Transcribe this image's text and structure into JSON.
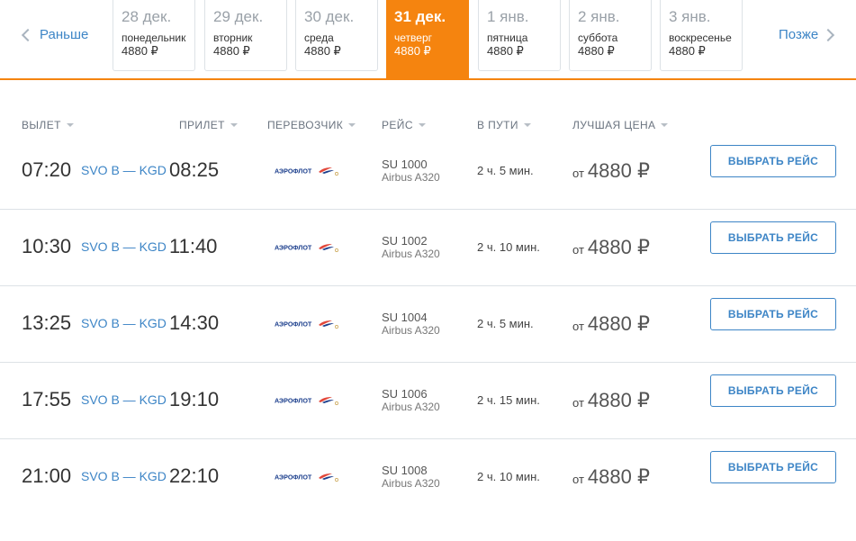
{
  "nav": {
    "prev_label": "Раньше",
    "next_label": "Позже"
  },
  "dates": [
    {
      "date": "28 дек.",
      "weekday": "понедельник",
      "price": "4880 ₽",
      "active": false
    },
    {
      "date": "29 дек.",
      "weekday": "вторник",
      "price": "4880 ₽",
      "active": false
    },
    {
      "date": "30 дек.",
      "weekday": "среда",
      "price": "4880 ₽",
      "active": false
    },
    {
      "date": "31 дек.",
      "weekday": "четверг",
      "price": "4880 ₽",
      "active": true
    },
    {
      "date": "1 янв.",
      "weekday": "пятница",
      "price": "4880 ₽",
      "active": false
    },
    {
      "date": "2 янв.",
      "weekday": "суббота",
      "price": "4880 ₽",
      "active": false
    },
    {
      "date": "3 янв.",
      "weekday": "воскресенье",
      "price": "4880 ₽",
      "active": false
    }
  ],
  "columns": {
    "departure": "ВЫЛЕТ",
    "arrival": "ПРИЛЕТ",
    "carrier": "ПЕРЕВОЗЧИК",
    "flight": "РЕЙС",
    "duration": "В ПУТИ",
    "best_price": "ЛУЧШАЯ ЦЕНА"
  },
  "airline_logo_text": "АЭРОФЛОТ",
  "flights": [
    {
      "dep": "07:20",
      "route": "SVO B — KGD",
      "arr": "08:25",
      "number": "SU 1000",
      "aircraft": "Airbus A320",
      "duration": "2 ч. 5 мин.",
      "from": "от",
      "price": "4880 ₽",
      "button": "ВЫБРАТЬ РЕЙС"
    },
    {
      "dep": "10:30",
      "route": "SVO B — KGD",
      "arr": "11:40",
      "number": "SU 1002",
      "aircraft": "Airbus A320",
      "duration": "2 ч. 10 мин.",
      "from": "от",
      "price": "4880 ₽",
      "button": "ВЫБРАТЬ РЕЙС"
    },
    {
      "dep": "13:25",
      "route": "SVO B — KGD",
      "arr": "14:30",
      "number": "SU 1004",
      "aircraft": "Airbus A320",
      "duration": "2 ч. 5 мин.",
      "from": "от",
      "price": "4880 ₽",
      "button": "ВЫБРАТЬ РЕЙС"
    },
    {
      "dep": "17:55",
      "route": "SVO B — KGD",
      "arr": "19:10",
      "number": "SU 1006",
      "aircraft": "Airbus A320",
      "duration": "2 ч. 15 мин.",
      "from": "от",
      "price": "4880 ₽",
      "button": "ВЫБРАТЬ РЕЙС"
    },
    {
      "dep": "21:00",
      "route": "SVO B — KGD",
      "arr": "22:10",
      "number": "SU 1008",
      "aircraft": "Airbus A320",
      "duration": "2 ч. 10 мин.",
      "from": "от",
      "price": "4880 ₽",
      "button": "ВЫБРАТЬ РЕЙС"
    }
  ],
  "colors": {
    "accent": "#f5840f",
    "link": "#3d85c6",
    "separator": "#dde2e6"
  }
}
